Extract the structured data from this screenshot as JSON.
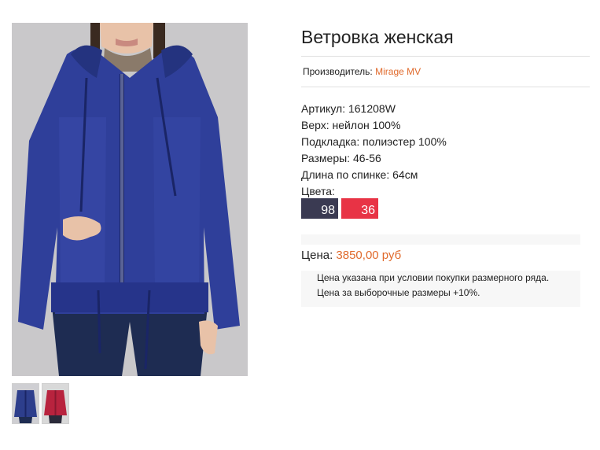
{
  "product": {
    "title": "Ветровка женская",
    "maker_label": "Производитель:",
    "maker_name": "Mirage MV",
    "specs": [
      "Артикул: 161208W",
      "Верх: нейлон 100%",
      "Подкладка: полиэстер 100%",
      "Размеры: 46-56",
      "Длина по спинке: 64см",
      "Цвета:"
    ],
    "colors": [
      {
        "code": "98",
        "hex": "#3a3a52"
      },
      {
        "code": "36",
        "hex": "#e83345"
      }
    ],
    "price_label": "Цена:",
    "price_value": "3850,00 руб",
    "notes": [
      "Цена указана при условии покупки размерного ряда.",
      "Цена за выборочные размеры +10%."
    ]
  },
  "gallery": {
    "thumbnails": [
      {
        "color": "#2d3e8c"
      },
      {
        "color": "#b8233e"
      }
    ]
  }
}
